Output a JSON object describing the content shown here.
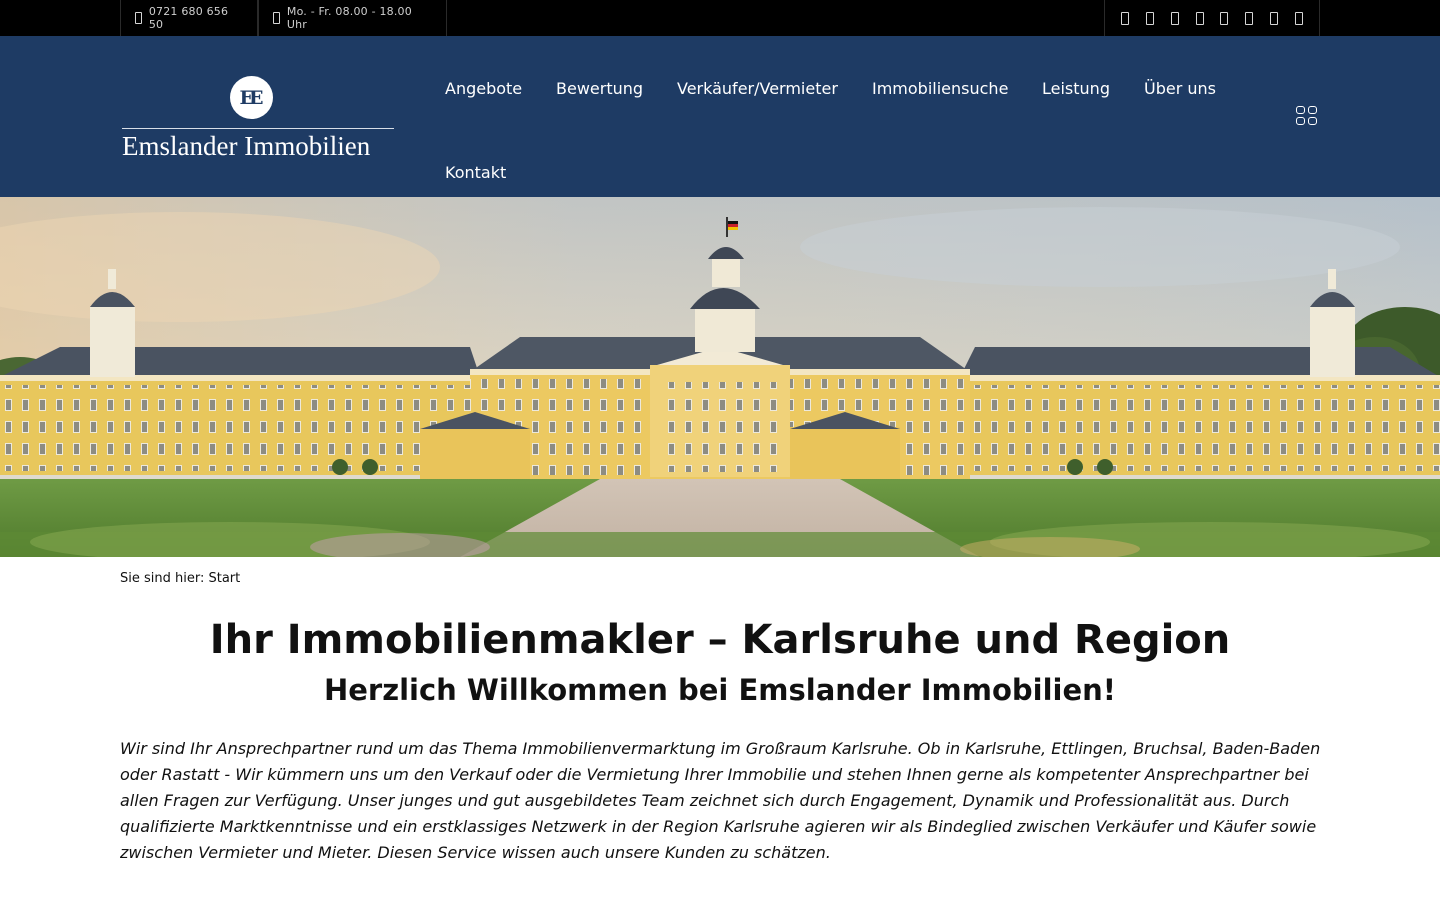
{
  "topbar": {
    "phone": "0721 680 656 50",
    "hours": "Mo. - Fr. 08.00 - 18.00 Uhr",
    "phone_icon": "mobile-phone-icon",
    "hours_icon": "clock-icon",
    "social_icons": [
      "social-icon-1",
      "social-icon-2",
      "social-icon-3",
      "social-icon-4",
      "social-icon-5",
      "social-icon-6",
      "social-icon-7",
      "social-icon-8"
    ]
  },
  "header": {
    "logo_monogram": "EE",
    "logo_text": "Emslander Immobilien",
    "nav": [
      {
        "label": "Angebote"
      },
      {
        "label": "Bewertung"
      },
      {
        "label": "Verkäufer/Vermieter"
      },
      {
        "label": "Immobiliensuche"
      },
      {
        "label": "Leistung"
      },
      {
        "label": "Über uns"
      },
      {
        "label": "Kontakt"
      }
    ],
    "menu_icon": "grid-menu-icon"
  },
  "hero": {
    "image": "karlsruhe-palace-photo"
  },
  "content": {
    "breadcrumb": "Sie sind hier: Start",
    "title": "Ihr Immobilienmakler – Karlsruhe und Region",
    "subtitle": "Herzlich Willkommen bei Emslander Immobilien!",
    "intro": "Wir sind Ihr Ansprechpartner rund um das Thema Immobilienvermarktung im Großraum Karlsruhe. Ob in Karlsruhe, Ettlingen, Bruchsal, Baden-Ba­den oder Rastatt - Wir kümmern uns um den Verkauf oder die Vermietung Ihrer Immobilie und stehen Ihnen gerne als kompetenter Ansprechpartner bei allen Fragen zur Verfügung. Unser junges und gut ausgebildetes Team zeichnet sich durch Engagement, Dynamik und Professionalität aus. Durch qualifizierte Marktkenntnisse und ein erstklassiges Netzwerk in der Region Karlsruhe agieren wir als Bindeglied zwischen Verkäufer und Käufer sowie zwischen Vermieter und Mieter. Diesen Service wissen auch unsere Kunden zu schätzen."
  },
  "colors": {
    "topbar": "#000000",
    "header": "#1e3b64",
    "text": "#111111"
  }
}
